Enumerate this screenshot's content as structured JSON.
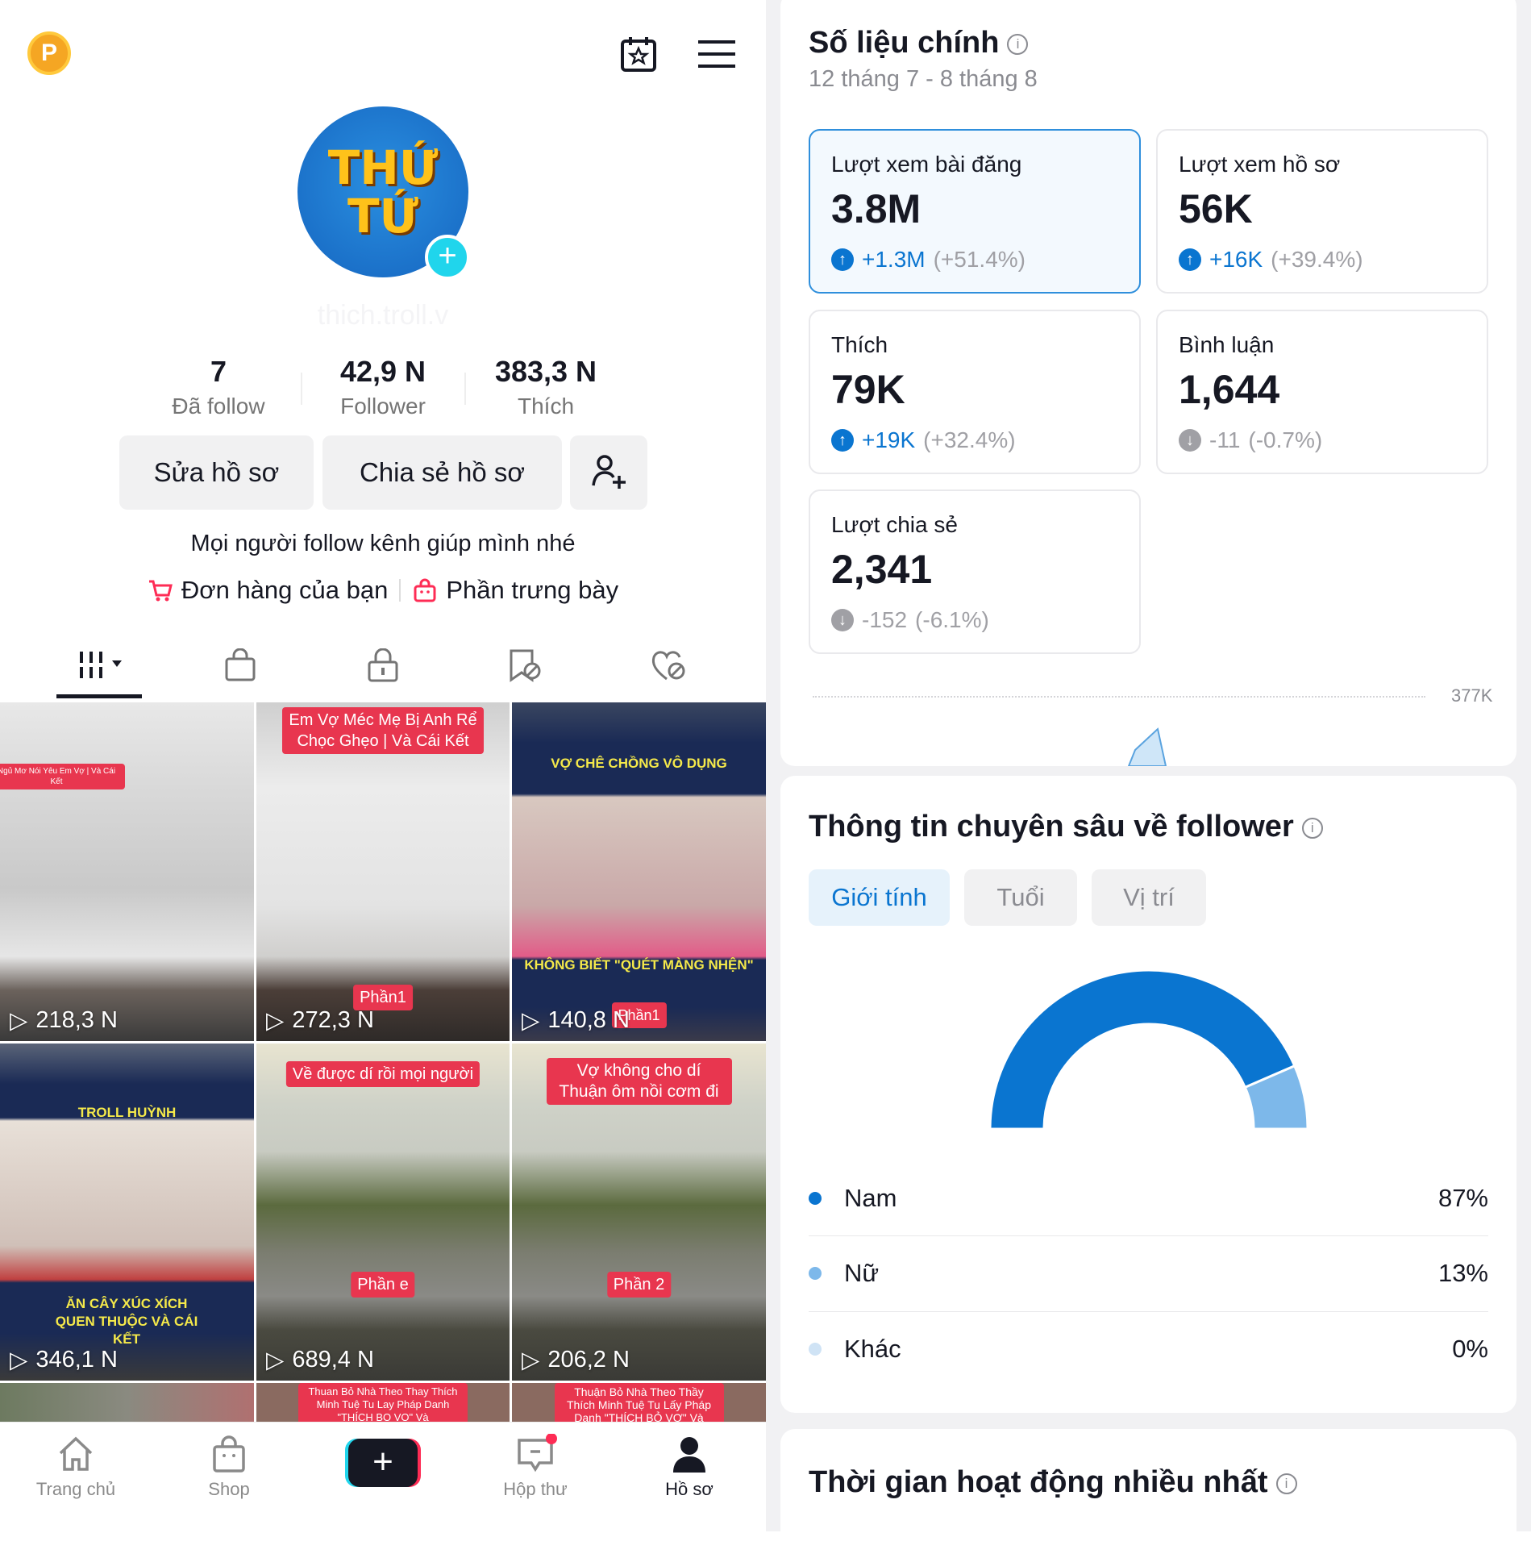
{
  "profile": {
    "coin_label": "P",
    "username": "thich.troll.v",
    "avatar_text": [
      "THỨ",
      "TỨ"
    ],
    "stats": [
      {
        "value": "7",
        "label": "Đã follow"
      },
      {
        "value": "42,9 N",
        "label": "Follower"
      },
      {
        "value": "383,3 N",
        "label": "Thích"
      }
    ],
    "edit_label": "Sửa hồ sơ",
    "share_label": "Chia sẻ hồ sơ",
    "bio": "Mọi người follow kênh giúp mình nhé",
    "orders_label": "Đơn hàng của bạn",
    "showcase_label": "Phần trưng bày"
  },
  "videos": [
    {
      "caption": "Ngủ Mơ Nói Yêu Em Vợ | Và Cái Kết",
      "views": "218,3 N"
    },
    {
      "caption": "Em Vợ Méc Mẹ Bị Anh Rể Chọc Ghẹo | Và Cái Kết",
      "tag": "Phần1",
      "views": "272,3 N"
    },
    {
      "top": "VỢ CHÊ CHỒNG VÔ DỤNG",
      "bottom": "KHÔNG BIẾT \"QUÉT MÀNG NHỆN\"",
      "tag": "Phần1",
      "views": "140,8 N"
    },
    {
      "top": "TROLL HUỲNH",
      "bottom": "ĂN CÂY XÚC XÍCH QUEN THUỘC VÀ CÁI KẾT",
      "views": "346,1 N"
    },
    {
      "caption": "Về được dí rồi mọi người",
      "tag": "Phần e",
      "views": "689,4 N"
    },
    {
      "caption": "Vợ không cho dí Thuận ôm nồi cơm đi",
      "tag": "Phần 2",
      "views": "206,2 N"
    },
    {
      "caption": ""
    },
    {
      "caption": "Thuan Bỏ Nhà Theo Thay Thích Minh Tuệ Tu Lay Pháp Danh \"THÍCH BO VO\" Và"
    },
    {
      "caption": "Thuận Bỏ Nhà Theo Thầy Thích Minh Tuệ Tu Lấy Pháp Danh \"THÍCH BỎ VỢ\" Và"
    }
  ],
  "nav": [
    {
      "label": "Trang chủ",
      "icon": "home-icon"
    },
    {
      "label": "Shop",
      "icon": "shop-icon"
    },
    {
      "label": "",
      "icon": "create-icon"
    },
    {
      "label": "Hộp thư",
      "icon": "inbox-icon"
    },
    {
      "label": "Hồ sơ",
      "icon": "profile-icon",
      "active": true
    }
  ],
  "metrics": {
    "title": "Số liệu chính",
    "date_range": "12 tháng 7 - 8 tháng 8",
    "items": [
      {
        "label": "Lượt xem bài đăng",
        "value": "3.8M",
        "change": "+1.3M",
        "pct": "(+51.4%)",
        "dir": "up",
        "selected": true
      },
      {
        "label": "Lượt xem hồ sơ",
        "value": "56K",
        "change": "+16K",
        "pct": "(+39.4%)",
        "dir": "up"
      },
      {
        "label": "Thích",
        "value": "79K",
        "change": "+19K",
        "pct": "(+32.4%)",
        "dir": "up"
      },
      {
        "label": "Bình luận",
        "value": "1,644",
        "change": "-11",
        "pct": "(-0.7%)",
        "dir": "down"
      },
      {
        "label": "Lượt chia sẻ",
        "value": "2,341",
        "change": "-152",
        "pct": "(-6.1%)",
        "dir": "down"
      }
    ],
    "chart_max_label": "377K"
  },
  "followers": {
    "title": "Thông tin chuyên sâu về follower",
    "tabs": [
      "Giới tính",
      "Tuổi",
      "Vị trí"
    ],
    "active_tab": 0,
    "chart_data": {
      "type": "pie",
      "style": "half-donut",
      "categories": [
        "Nam",
        "Nữ",
        "Khác"
      ],
      "values": [
        87,
        13,
        0
      ],
      "colors": [
        "#0a75d0",
        "#7db8ea",
        "#cfe3f5"
      ]
    },
    "legend": [
      {
        "label": "Nam",
        "value": "87%"
      },
      {
        "label": "Nữ",
        "value": "13%"
      },
      {
        "label": "Khác",
        "value": "0%"
      }
    ]
  },
  "active_time": {
    "title": "Thời gian hoạt động nhiều nhất"
  },
  "colors": {
    "accent": "#0a75d0",
    "up": "#0a75d0",
    "down": "#a0a0a5",
    "brand_red": "#fe2c55",
    "brand_cyan": "#20d5ec"
  }
}
